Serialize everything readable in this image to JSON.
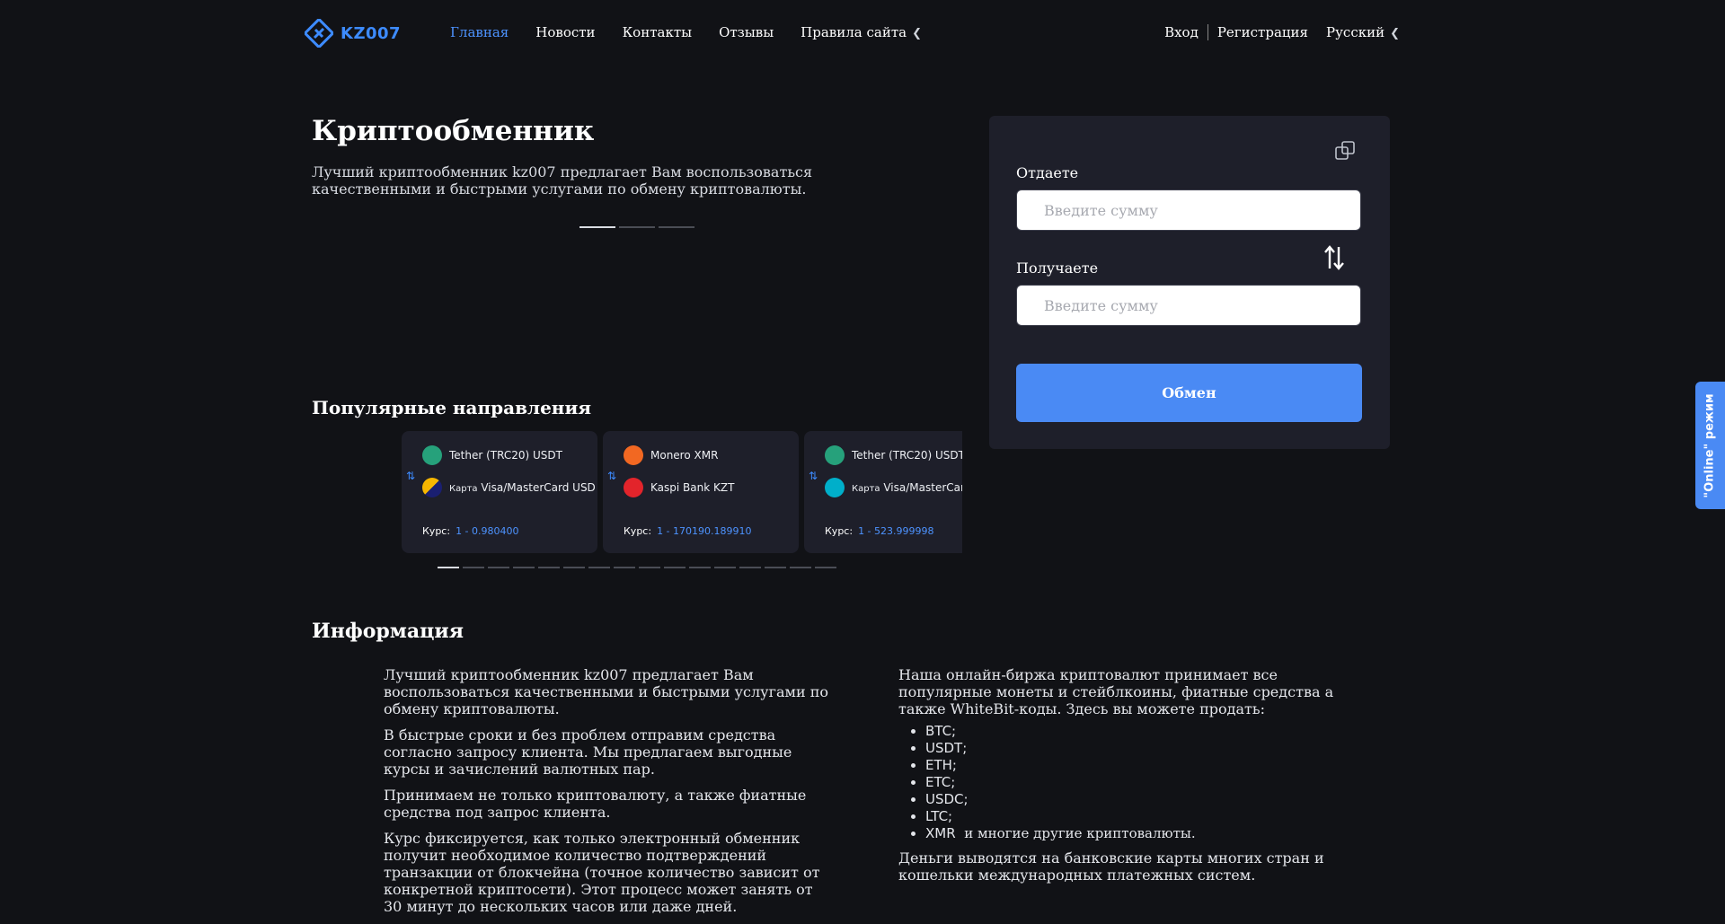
{
  "header": {
    "logo_text": "KZ007",
    "nav": [
      {
        "label": "Главная",
        "active": true
      },
      {
        "label": "Новости"
      },
      {
        "label": "Контакты"
      },
      {
        "label": "Отзывы"
      },
      {
        "label": "Правила сайта",
        "chevron": "chevron-left-icon"
      }
    ],
    "login": "Вход",
    "register": "Регистрация",
    "language": "Русский"
  },
  "hero": {
    "title": "Криптообменник",
    "text": "Лучший криптообменник kz007 предлагает Вам воспользоваться качественными и быстрыми услугами по обмену криптовалюты.",
    "slide_dots": 3,
    "active_slide": 1
  },
  "exchange": {
    "give_label": "Отдаете",
    "give_placeholder": "Введите сумму",
    "get_label": "Получаете",
    "get_placeholder": "Введите сумму",
    "button": "Обмен"
  },
  "popular": {
    "title": "Популярные направления",
    "rate_label": "Курс:",
    "cards": [
      {
        "from": "Tether (TRC20) USDT",
        "to_prefix": "Карта",
        "to": "Visa/MasterCard USD",
        "rate": "1 - 0.980400"
      },
      {
        "from": "Monero XMR",
        "to_prefix": "",
        "to": "Kaspi Bank KZT",
        "rate": "1 - 170190.189910"
      },
      {
        "from": "Tether (TRC20) USDT",
        "to_prefix": "Карта",
        "to": "Visa/MasterCard",
        "rate": "1 - 523.999998"
      }
    ],
    "dots": 16,
    "active_dot": 1
  },
  "info": {
    "title": "Информация",
    "left": [
      "Лучший криптообменник kz007 предлагает Вам воспользоваться качественными и быстрыми услугами по обмену криптовалюты.",
      "В быстрые сроки и без проблем отправим средства согласно запросу клиента. Мы предлагаем выгодные курсы и зачислений валютных пар.",
      "Принимаем не только криптовалюту, а также фиатные средства под запрос клиента.",
      "Курс фиксируется, как только электронный обменник получит необходимое количество подтверждений транзакции от блокчейна (точное количество зависит от конкретной криптосети). Этот процесс может занять от 30 минут до нескольких часов или даже дней."
    ],
    "right_intro": "Наша онлайн-биржа криптовалют принимает все популярные монеты и стейблкоины, фиатные средства а также WhiteBit-коды. Здесь вы можете продать:",
    "coins": [
      "BTC;",
      "USDT;",
      "ETH;",
      "ETC;",
      "USDC;",
      "LTC;",
      "XMR"
    ],
    "coins_tail": "и многие другие криптовалюты.",
    "right_outro": "Деньги выводятся на банковские карты многих стран и кошельки международных платежных систем."
  },
  "online_tab": "\"Online\" режим",
  "colors": {
    "accent": "#4a8af4",
    "background": "#111216",
    "card": "#1e1f2a"
  }
}
